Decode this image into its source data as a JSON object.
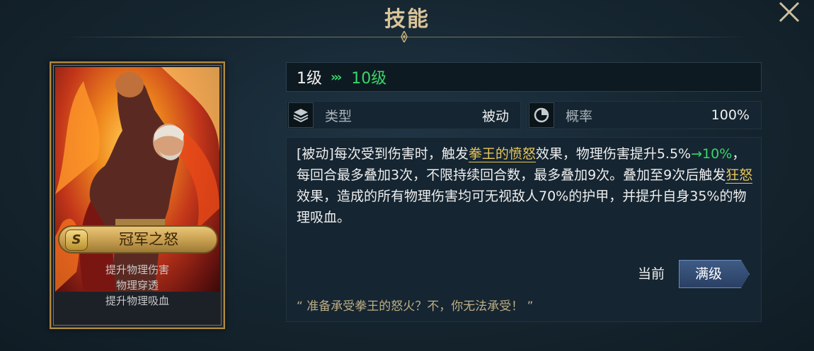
{
  "header": {
    "title": "技能"
  },
  "card": {
    "rank": "S",
    "name": "冠军之怒",
    "tags": [
      "提升物理伤害",
      "物理穿透",
      "提升物理吸血"
    ]
  },
  "level": {
    "from": "1级",
    "arrows": "›››",
    "to": "10级"
  },
  "stats": {
    "type_label": "类型",
    "type_value": "被动",
    "rate_label": "概率",
    "rate_value": "100%"
  },
  "description": {
    "p1": "[被动]每次受到伤害时，触发",
    "link1": "拳王的愤怒",
    "p2": "效果，物理伤害提升5.5%",
    "arrow_value": "→10%",
    "p3": "，每回合最多叠加3次，不限持续回合数，最多叠加9次。叠加至9次后触发",
    "link2": "狂怒",
    "p4": "效果，造成的所有物理伤害均可无视敌人70%的护甲，并提升自身35%的物理吸血。"
  },
  "tabs": {
    "current": "当前",
    "max": "满级"
  },
  "quote": "“ 准备承受拳王的怒火？不，你无法承受！ ”",
  "colors": {
    "accent_green": "#38d66a",
    "gold": "#e8c65a",
    "title_gold": "#d9c49a"
  }
}
